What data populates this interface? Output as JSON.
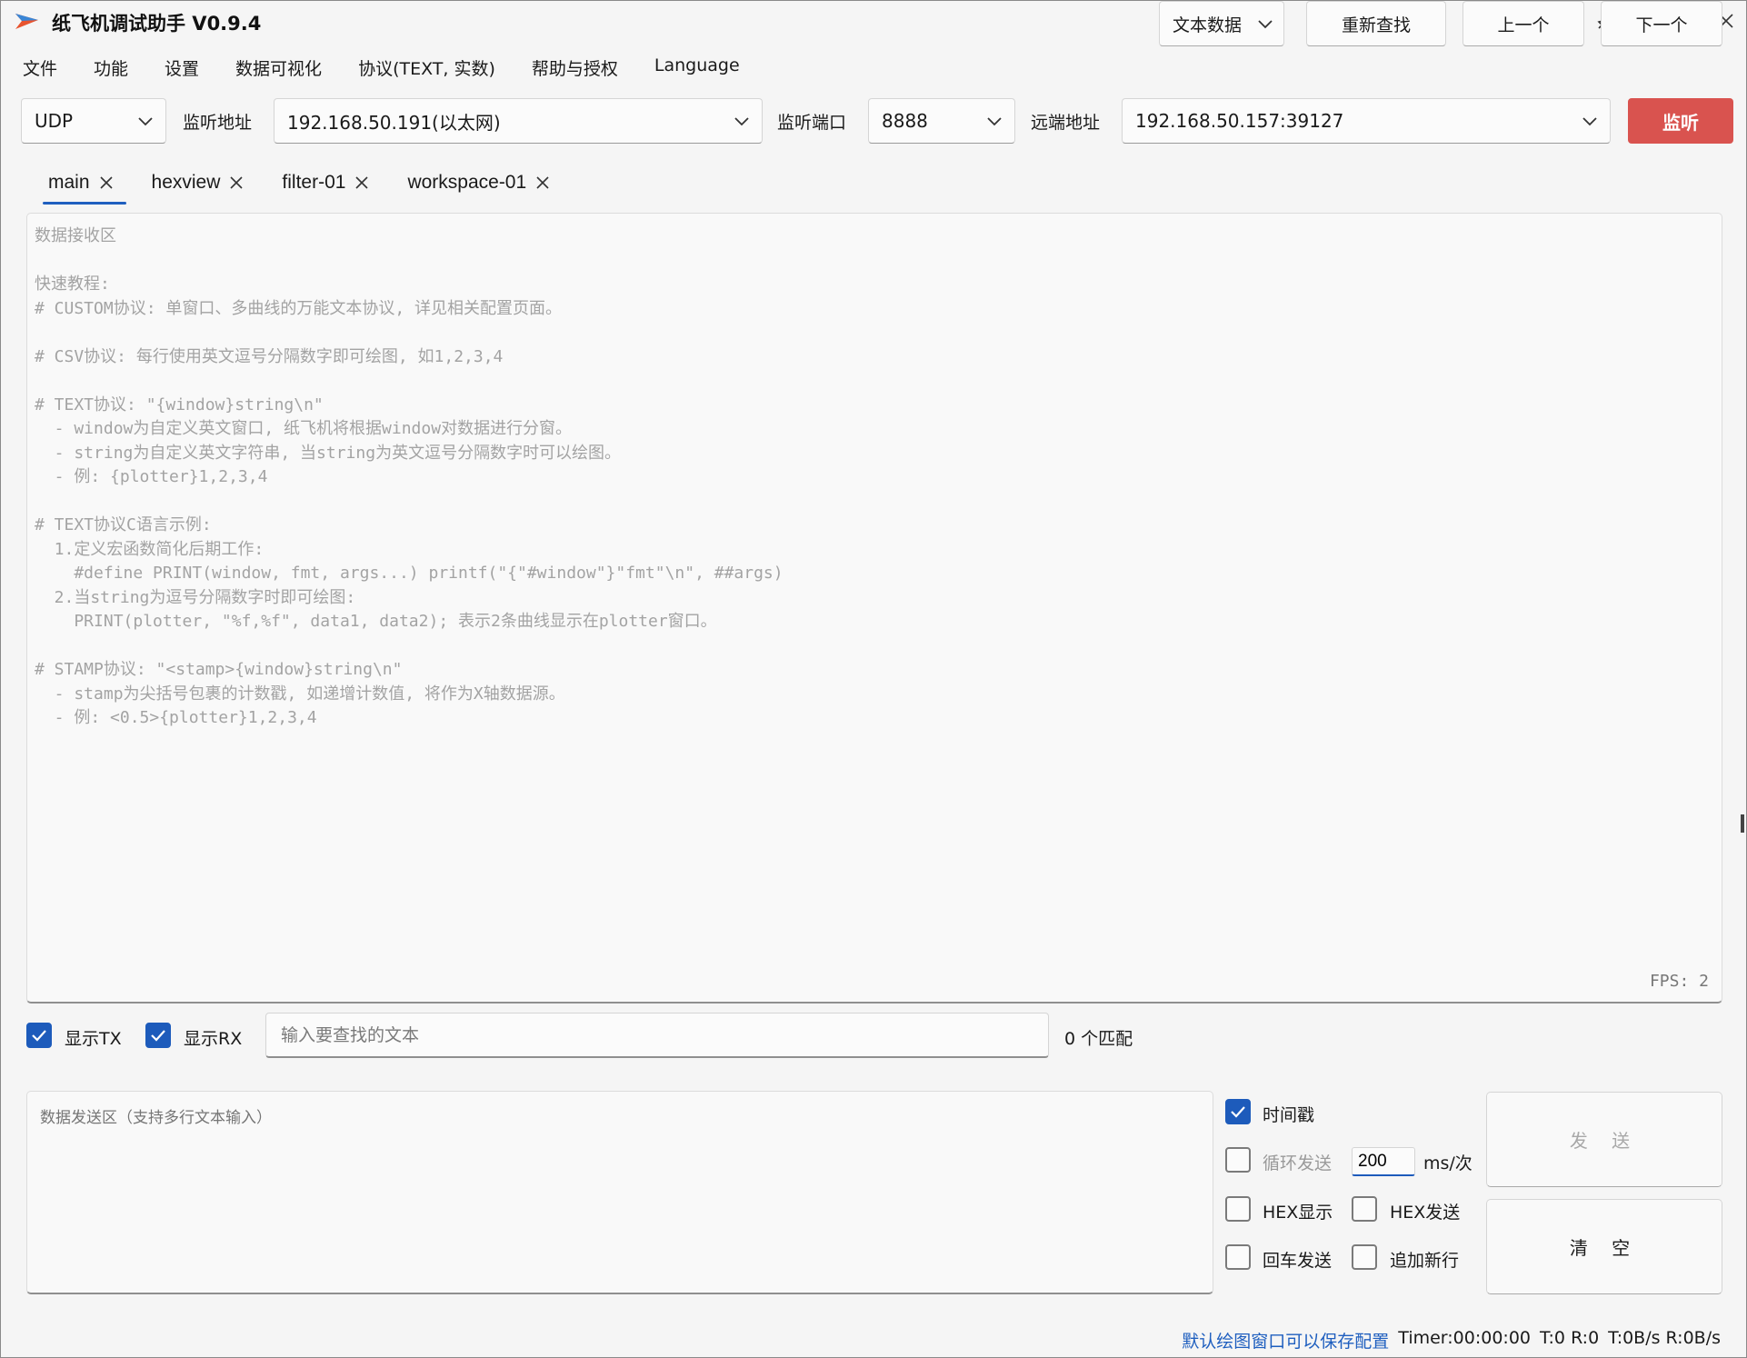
{
  "app": {
    "title": "纸飞机调试助手 V0.9.4"
  },
  "window_controls": [
    "moon-icon",
    "pin-icon",
    "minimize-icon",
    "maximize-icon",
    "close-icon"
  ],
  "menu": [
    "文件",
    "功能",
    "设置",
    "数据可视化",
    "协议(TEXT, 实数)",
    "帮助与授权",
    "Language"
  ],
  "connection": {
    "protocol": "UDP",
    "listen_addr_label": "监听地址",
    "listen_addr": "192.168.50.191(以太网)",
    "listen_port_label": "监听端口",
    "listen_port": "8888",
    "remote_addr_label": "远端地址",
    "remote_addr": "192.168.50.157:39127",
    "listen_button": "监听"
  },
  "tabs": [
    {
      "label": "main",
      "active": true
    },
    {
      "label": "hexview",
      "active": false
    },
    {
      "label": "filter-01",
      "active": false
    },
    {
      "label": "workspace-01",
      "active": false
    }
  ],
  "receive": {
    "placeholder": "数据接收区\n\n快速教程:\n# CUSTOM协议: 单窗口、多曲线的万能文本协议, 详见相关配置页面。\n\n# CSV协议: 每行使用英文逗号分隔数字即可绘图, 如1,2,3,4\n\n# TEXT协议: \"{window}string\\n\"\n  - window为自定义英文窗口, 纸飞机将根据window对数据进行分窗。\n  - string为自定义英文字符串, 当string为英文逗号分隔数字时可以绘图。\n  - 例: {plotter}1,2,3,4\n\n# TEXT协议C语言示例:\n  1.定义宏函数简化后期工作:\n    #define PRINT(window, fmt, args...) printf(\"{\"#window\"}\"fmt\"\\n\", ##args)\n  2.当string为逗号分隔数字时即可绘图:\n    PRINT(plotter, \"%f,%f\", data1, data2); 表示2条曲线显示在plotter窗口。\n\n# STAMP协议: \"<stamp>{window}string\\n\"\n  - stamp为尖括号包裹的计数戳, 如递增计数值, 将作为X轴数据源。\n  - 例: <0.5>{plotter}1,2,3,4",
    "fps": "FPS: 2"
  },
  "search_row": {
    "show_tx_label": "显示TX",
    "show_tx": true,
    "show_rx_label": "显示RX",
    "show_rx": true,
    "search_placeholder": "输入要查找的文本",
    "match_count": "0 个匹配",
    "data_type": "文本数据",
    "research_button": "重新查找",
    "prev_button": "上一个",
    "next_button": "下一个"
  },
  "send": {
    "placeholder": "数据发送区（支持多行文本输入）",
    "timestamp_label": "时间戳",
    "timestamp": true,
    "loop_send_label": "循环发送",
    "loop_send": false,
    "interval": "200",
    "interval_unit": "ms/次",
    "hex_display_label": "HEX显示",
    "hex_display": false,
    "hex_send_label": "HEX发送",
    "hex_send": false,
    "enter_send_label": "回车发送",
    "enter_send": false,
    "append_newline_label": "追加新行",
    "append_newline": false,
    "send_button": "发 送",
    "clear_button": "清 空"
  },
  "status": {
    "hint_link": "默认绘图窗口可以保存配置",
    "timer": "Timer:00:00:00",
    "counts": "T:0 R:0",
    "rates": "T:0B/s R:0B/s"
  },
  "colors": {
    "accent": "#1d5bbb",
    "listen_button": "#d9534f",
    "link": "#1f5fbf"
  }
}
